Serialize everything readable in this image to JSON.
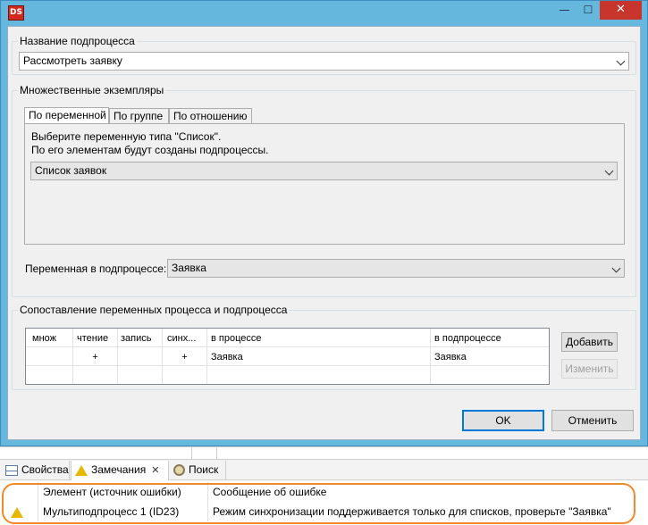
{
  "window": {
    "icon_text": "DS",
    "minimize": "—",
    "maximize": "☐",
    "close": "✕"
  },
  "subprocess_name": {
    "label": "Название подпроцесса",
    "value": "Рассмотреть заявку"
  },
  "multi_instance": {
    "label": "Множественные экземпляры",
    "tabs": [
      {
        "label": "По переменной",
        "active": true
      },
      {
        "label": "По группе",
        "active": false
      },
      {
        "label": "По отношению",
        "active": false
      }
    ],
    "instruction_line1": "Выберите переменную типа \"Список\".",
    "instruction_line2": "По его элементам будут созданы подпроцессы.",
    "list_value": "Список заявок",
    "subprocess_var_label": "Переменная в подпроцессе:",
    "subprocess_var_value": "Заявка"
  },
  "mapping": {
    "label": "Сопоставление переменных процесса и подпроцесса",
    "columns": [
      "множ",
      "чтение",
      "запись",
      "синх...",
      "в процессе",
      "в подпроцессе"
    ],
    "rows": [
      [
        "",
        "+",
        "",
        "+",
        "Заявка",
        "Заявка"
      ]
    ],
    "add_button": "Добавить",
    "edit_button": "Изменить"
  },
  "dialog_buttons": {
    "ok": "OK",
    "cancel": "Отменить"
  },
  "bottom_panel": {
    "tabs": [
      {
        "label": "Свойства",
        "icon": "properties-icon",
        "active": false
      },
      {
        "label": "Замечания",
        "icon": "warning-icon",
        "active": true,
        "closable": true
      },
      {
        "label": "Поиск",
        "icon": "search-icon",
        "active": false
      }
    ],
    "close_glyph": "✕",
    "columns": [
      "Элемент (источник ошибки)",
      "Сообщение об ошибке"
    ],
    "rows": [
      {
        "severity": "warning",
        "element": "Мультиподпроцесс 1 (ID23)",
        "message": "Режим синхронизации поддерживается только для списков, проверьте \"Заявка\""
      }
    ]
  },
  "colors": {
    "title_bar": "#65b7dd",
    "close_button": "#c7352c",
    "highlight": "#f08a2c",
    "warning": "#e6b800"
  }
}
